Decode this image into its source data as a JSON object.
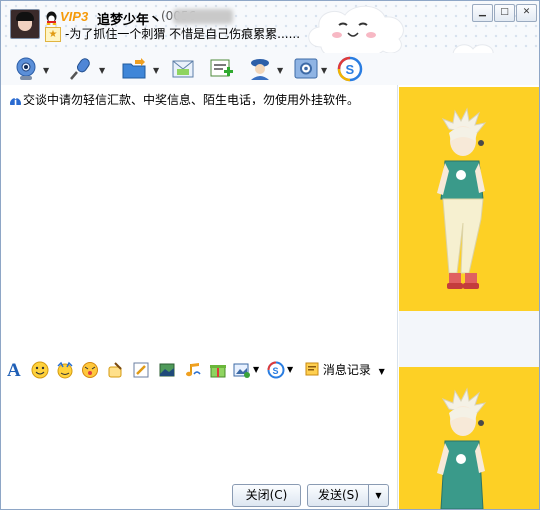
{
  "contact": {
    "vip_label": "VIP3",
    "nickname": "追梦少年丶",
    "qq_number_partial": "(0056",
    "signature": "-为了抓住一个刺猬 不惜是自己伤痕累累......"
  },
  "window_controls": [
    "minimize",
    "maximize",
    "close"
  ],
  "toolbar_icons": [
    "video-call-icon",
    "voice-call-icon",
    "send-file-icon",
    "send-sms-icon",
    "create-group-icon",
    "remote-assist-icon",
    "settings-app-icon",
    "soso-icon"
  ],
  "notice": "交谈中请勿轻信汇款、中奖信息、陌生电话，勿使用外挂软件。",
  "format_bar": {
    "font_label": "A",
    "message_log_label": "消息记录"
  },
  "buttons": {
    "close_label": "关闭(C)",
    "send_label": "发送(S)"
  },
  "colors": {
    "accent_blue": "#2b6bd0",
    "vip_orange": "#f59a0a",
    "show_bg_yellow": "#fdd025"
  }
}
